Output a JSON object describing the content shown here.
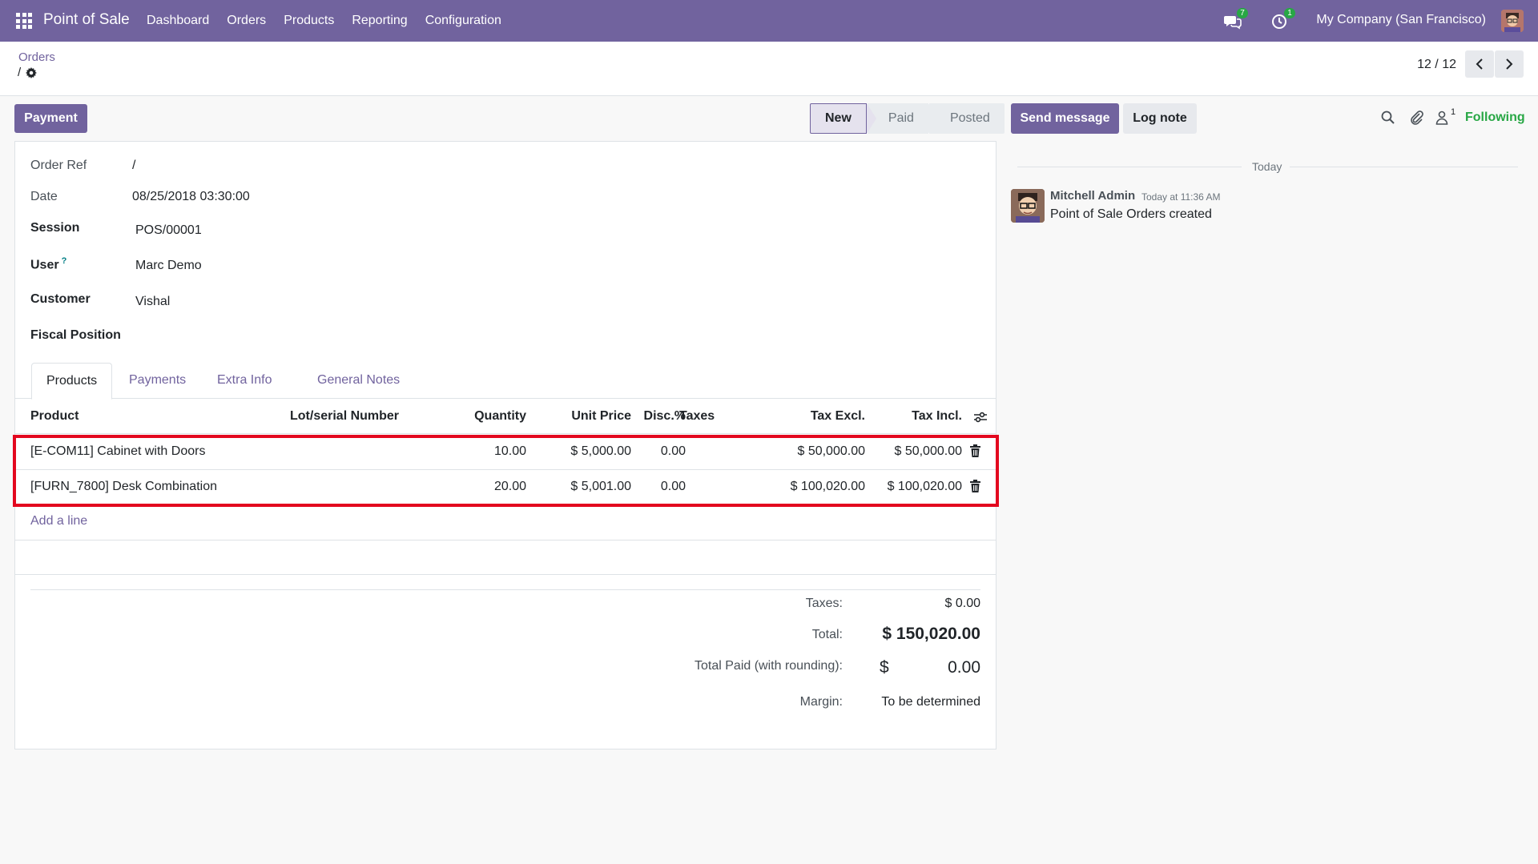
{
  "navbar": {
    "app_name": "Point of Sale",
    "menu": [
      "Dashboard",
      "Orders",
      "Products",
      "Reporting",
      "Configuration"
    ],
    "messages_badge": "7",
    "activities_badge": "1",
    "company": "My Company (San Francisco)"
  },
  "breadcrumb": {
    "parent": "Orders",
    "current": "/"
  },
  "pager": {
    "value": "12 / 12"
  },
  "actions": {
    "payment": "Payment"
  },
  "statusbar": {
    "stages": [
      "New",
      "Paid",
      "Posted"
    ],
    "active": "New"
  },
  "form": {
    "order_ref_label": "Order Ref",
    "order_ref": "/",
    "date_label": "Date",
    "date": "08/25/2018 03:30:00",
    "session_label": "Session",
    "session": "POS/00001",
    "user_label": "User",
    "user_help": "?",
    "user": "Marc Demo",
    "customer_label": "Customer",
    "customer": "Vishal",
    "fiscal_position_label": "Fiscal Position"
  },
  "tabs": [
    "Products",
    "Payments",
    "Extra Info",
    "General Notes"
  ],
  "lines": {
    "headers": {
      "product": "Product",
      "lot": "Lot/serial Number",
      "quantity": "Quantity",
      "unit_price": "Unit Price",
      "discount": "Disc.%",
      "taxes": "Taxes",
      "tax_excl": "Tax Excl.",
      "tax_incl": "Tax Incl."
    },
    "rows": [
      {
        "product": "[E-COM11] Cabinet with Doors",
        "quantity": "10.00",
        "unit_price": "$ 5,000.00",
        "discount": "0.00",
        "tax_excl": "$ 50,000.00",
        "tax_incl": "$ 50,000.00"
      },
      {
        "product": "[FURN_7800] Desk Combination",
        "quantity": "20.00",
        "unit_price": "$ 5,001.00",
        "discount": "0.00",
        "tax_excl": "$ 100,020.00",
        "tax_incl": "$ 100,020.00"
      }
    ],
    "add_line": "Add a line"
  },
  "totals": {
    "taxes_label": "Taxes:",
    "taxes": "$ 0.00",
    "total_label": "Total:",
    "total": "$ 150,020.00",
    "paid_label": "Total Paid (with rounding):",
    "paid_currency": "$",
    "paid_amount": "0.00",
    "margin_label": "Margin:",
    "margin": "To be determined"
  },
  "chatter": {
    "send_message": "Send message",
    "log_note": "Log note",
    "follower_count": "1",
    "following": "Following",
    "today": "Today",
    "message": {
      "author": "Mitchell Admin",
      "date": "Today at 11:36 AM",
      "body": "Point of Sale Orders created"
    }
  },
  "colors": {
    "brand": "#71639e",
    "highlight": "#e3081f",
    "following": "#28a745"
  }
}
